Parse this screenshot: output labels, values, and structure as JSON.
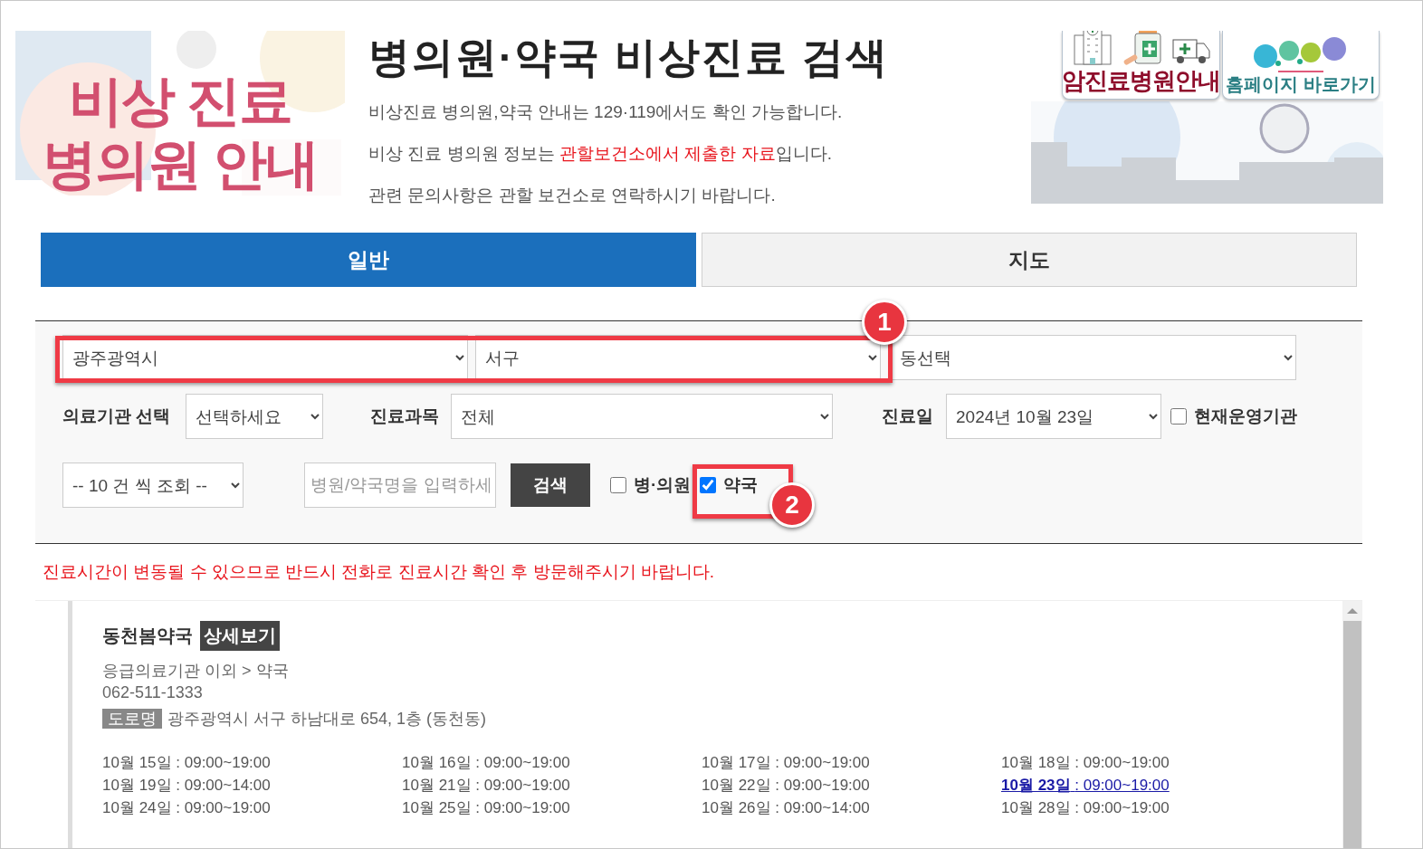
{
  "logo": {
    "lines": [
      "비상 진료",
      "병의원 안내"
    ]
  },
  "header": {
    "title": "병의원·약국 비상진료 검색",
    "lines": [
      {
        "parts": [
          {
            "text": "비상진료 병의원,약국 안내는 129·119에서도 확인 가능합니다.",
            "emphasis": false
          }
        ]
      },
      {
        "parts": [
          {
            "text": "비상 진료 병의원 정보는 ",
            "emphasis": false
          },
          {
            "text": "관할보건소에서 제출한 자료",
            "emphasis": true
          },
          {
            "text": "입니다.",
            "emphasis": false
          }
        ]
      },
      {
        "parts": [
          {
            "text": "관련 문의사항은 관할 보건소로 연락하시기 바랍니다.",
            "emphasis": false
          }
        ]
      }
    ]
  },
  "banner": {
    "links": [
      {
        "label": "암진료병원안내",
        "kind": "cancer"
      },
      {
        "label": "홈페이지 바로가기",
        "kind": "homepage"
      }
    ]
  },
  "tabs": [
    {
      "label": "일반",
      "selected": true
    },
    {
      "label": "지도",
      "selected": false
    }
  ],
  "filters": {
    "city": "광주광역시",
    "district": "서구",
    "dong": "동선택",
    "institution_label": "의료기관 선택",
    "institution": "선택하세요",
    "department_label": "진료과목",
    "department": "전체",
    "date_label": "진료일",
    "date": "2024년 10월 23일",
    "open_now": {
      "label": "현재운영기관",
      "checked": false
    },
    "page_size": "-- 10 건 씩 조회 --",
    "search_placeholder": "병원/약국명을 입력하세",
    "search_button": "검색",
    "types": [
      {
        "label": "병·의원",
        "checked": false
      },
      {
        "label": "약국",
        "checked": true
      }
    ]
  },
  "annotations": [
    {
      "label": "1"
    },
    {
      "label": "2"
    }
  ],
  "notice": "진료시간이 변동될 수 있으므로 반드시 전화로 진료시간 확인 후 방문해주시기 바랍니다.",
  "results": [
    {
      "name": "동천봄약국",
      "detail_button": "상세보기",
      "category": "응급의료기관 이외 > 약국",
      "phone": "062-511-1333",
      "address_tag": "도로명",
      "address": "광주광역시 서구 하남대로 654, 1층 (동천동)",
      "schedule": [
        {
          "date": "10월 15일",
          "hours": ": 09:00~19:00",
          "today": false
        },
        {
          "date": "10월 16일",
          "hours": ": 09:00~19:00",
          "today": false
        },
        {
          "date": "10월 17일",
          "hours": ": 09:00~19:00",
          "today": false
        },
        {
          "date": "10월 18일",
          "hours": ": 09:00~19:00",
          "today": false
        },
        {
          "date": "10월 19일",
          "hours": ": 09:00~14:00",
          "today": false
        },
        {
          "date": "10월 21일",
          "hours": ": 09:00~19:00",
          "today": false
        },
        {
          "date": "10월 22일",
          "hours": ": 09:00~19:00",
          "today": false
        },
        {
          "date": "10월 23일",
          "hours": ": 09:00~19:00",
          "today": true
        },
        {
          "date": "10월 24일",
          "hours": ": 09:00~19:00",
          "today": false
        },
        {
          "date": "10월 25일",
          "hours": ": 09:00~19:00",
          "today": false
        },
        {
          "date": "10월 26일",
          "hours": ": 09:00~14:00",
          "today": false
        },
        {
          "date": "10월 28일",
          "hours": ": 09:00~19:00",
          "today": false
        }
      ]
    }
  ]
}
